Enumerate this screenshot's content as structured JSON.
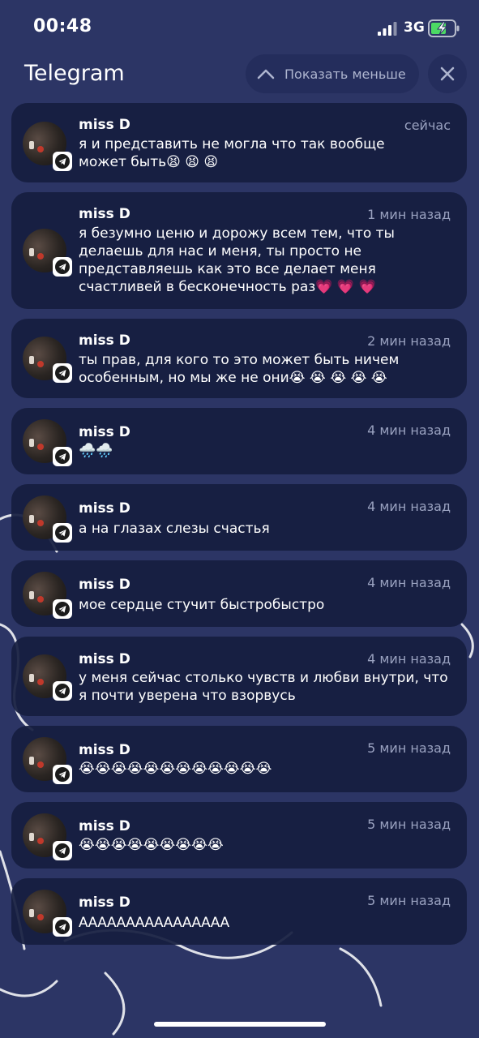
{
  "status_bar": {
    "time": "00:48",
    "network": "3G"
  },
  "header": {
    "title": "Telegram",
    "show_less_label": "Показать меньше"
  },
  "notifications": [
    {
      "sender": "miss D",
      "time": "сейчас",
      "text": "я и представить не могла что так вообще\nможет быть😫 😫 😫"
    },
    {
      "sender": "miss D",
      "time": "1 мин назад",
      "text": "я безумно ценю и дорожу всем тем, что ты\nделаешь для нас и меня, ты просто не\nпредставляешь как это все делает меня\nсчастливей в бесконечность раз💗 💗 💗"
    },
    {
      "sender": "miss D",
      "time": "2 мин назад",
      "text": "ты прав, для кого то это может быть ничем\nособенным, но мы же не они😭 😭 😭 😭 😭"
    },
    {
      "sender": "miss D",
      "time": "4 мин назад",
      "text": "🌧️🌧️"
    },
    {
      "sender": "miss D",
      "time": "4 мин назад",
      "text": "а на глазах слезы счастья"
    },
    {
      "sender": "miss D",
      "time": "4 мин назад",
      "text": "мое сердце стучит быстробыстро"
    },
    {
      "sender": "miss D",
      "time": "4 мин назад",
      "text": "у меня сейчас столько чувств и любви внутри, что\nя почти уверена что взорвусь"
    },
    {
      "sender": "miss D",
      "time": "5 мин назад",
      "text": "😭😭😭😭😭😭😭😭😭😭😭😭"
    },
    {
      "sender": "miss D",
      "time": "5 мин назад",
      "text": "😭😭😭😭😭😭😭😭😭"
    },
    {
      "sender": "miss D",
      "time": "5 мин назад",
      "text": "АААААААААААААААА"
    }
  ],
  "icons": {
    "avatar": "avatar-photo",
    "app_badge": "telegram-icon",
    "chevron": "chevron-up-icon",
    "close": "close-icon"
  },
  "colors": {
    "background": "#2c3565",
    "card": "#161e3f",
    "secondary_text": "#9aa2c0"
  }
}
